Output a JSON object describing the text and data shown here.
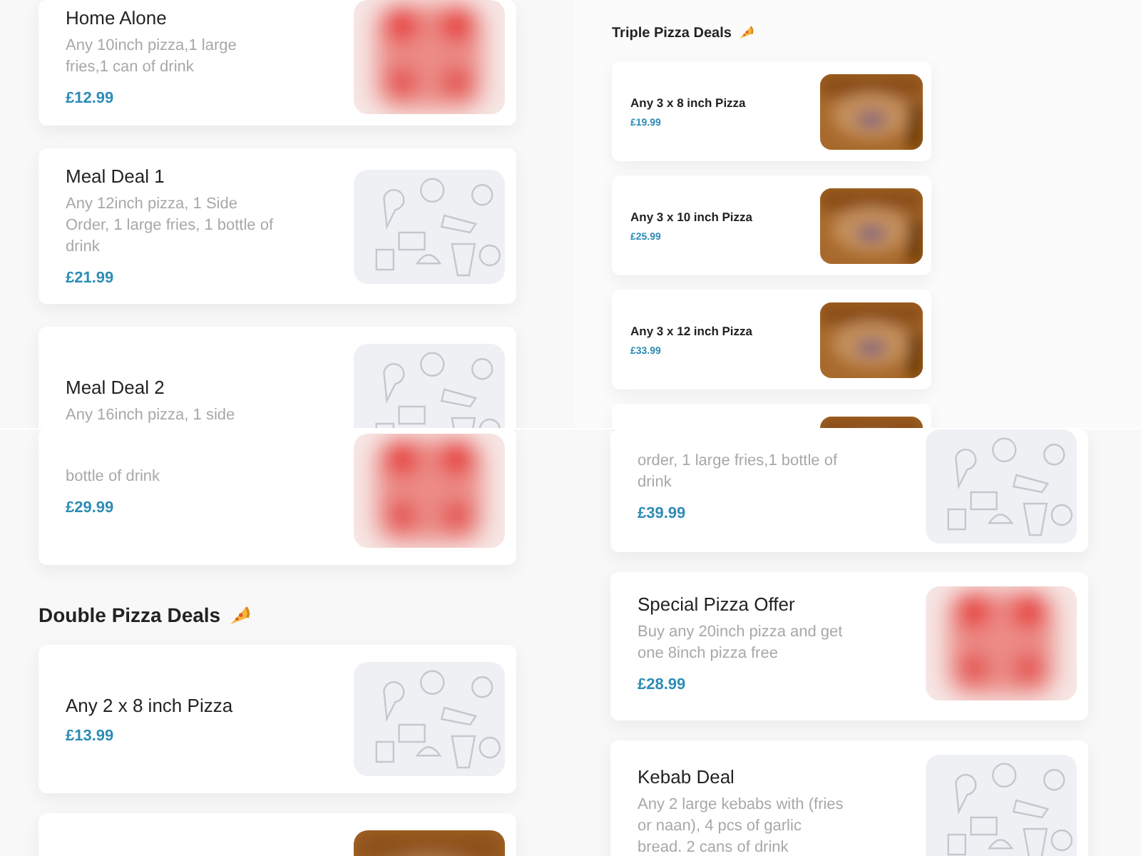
{
  "top": {
    "left_cards": [
      {
        "title": "Home Alone",
        "description": "Any 10inch pizza,1 large fries,1 can of drink",
        "price": "£12.99",
        "kind": "pizza"
      },
      {
        "title": "Meal Deal 1",
        "description": "Any 12inch pizza, 1 Side Order, 1 large fries, 1 bottle of drink",
        "price": "£21.99",
        "kind": "pattern"
      },
      {
        "title": "Meal Deal 2",
        "description": "Any 16inch pizza, 1 side",
        "kind": "pattern"
      }
    ],
    "section": {
      "heading": "Triple Pizza Deals",
      "cards": [
        {
          "title": "Any 3 x 8 inch Pizza",
          "price": "£19.99",
          "kind": "crust"
        },
        {
          "title": "Any 3 x 10 inch Pizza",
          "price": "£25.99",
          "kind": "crust"
        },
        {
          "title": "Any 3 x 12 inch Pizza",
          "price": "£33.99",
          "kind": "crust"
        },
        {
          "kind": "crust"
        }
      ]
    }
  },
  "bottom": {
    "left_cards": [
      {
        "description": "bottle of drink",
        "price": "£29.99",
        "kind": "pizza"
      }
    ],
    "section": {
      "heading": "Double Pizza Deals",
      "cards": [
        {
          "title": "Any 2 x 8 inch Pizza",
          "price": "£13.99",
          "kind": "pattern"
        },
        {
          "kind": "crust"
        }
      ]
    },
    "right_cards": [
      {
        "description": "order, 1 large fries,1 bottle of drink",
        "price": "£39.99",
        "kind": "pattern"
      },
      {
        "title": "Special Pizza Offer",
        "description": "Buy any 20inch pizza and get one 8inch pizza free",
        "price": "£28.99",
        "kind": "pizza"
      },
      {
        "title": "Kebab Deal",
        "description": "Any 2 large kebabs with (fries or naan), 4 pcs of garlic bread. 2 cans of drink",
        "kind": "pattern"
      }
    ]
  }
}
